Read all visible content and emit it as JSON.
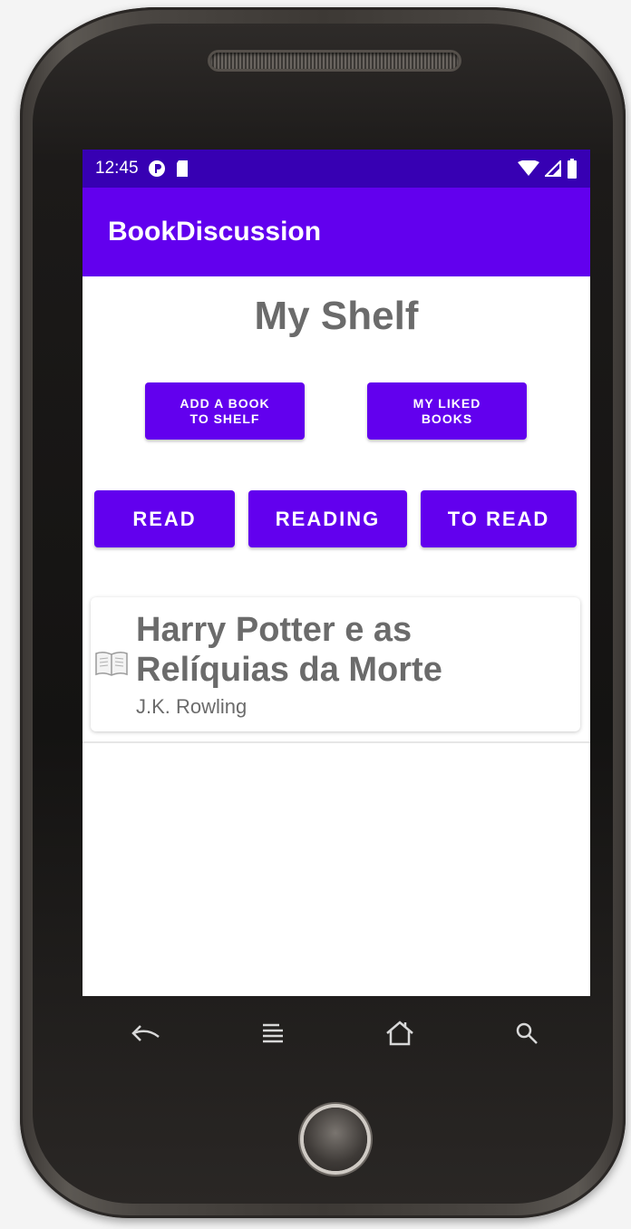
{
  "status_bar": {
    "time": "12:45"
  },
  "app_bar": {
    "title": "BookDiscussion"
  },
  "page": {
    "title": "My Shelf"
  },
  "actions": {
    "add_book": "ADD A BOOK\nTO SHELF",
    "liked_books": "MY LIKED\nBOOKS"
  },
  "filters": {
    "read": "READ",
    "reading": "READING",
    "to_read": "TO READ"
  },
  "books": [
    {
      "title": "Harry Potter e as Relíquias da Morte",
      "author": "J.K. Rowling",
      "cover_icon": "book-icon"
    }
  ],
  "colors": {
    "primary": "#6200ee",
    "primary_dark": "#3700b3",
    "text_gray": "#6b6b6b"
  }
}
